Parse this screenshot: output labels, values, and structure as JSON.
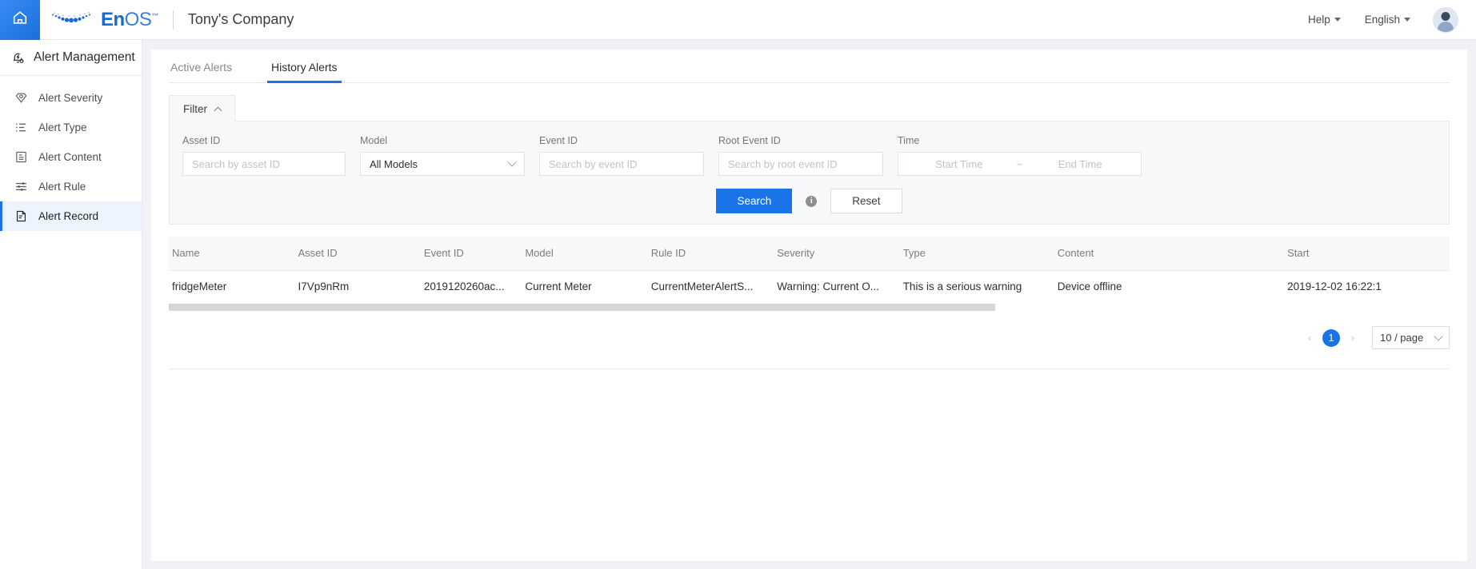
{
  "topbar": {
    "home_icon": "home-icon",
    "logo_text_en": "En",
    "logo_text_os": "OS",
    "logo_tm": "™",
    "company": "Tony's Company",
    "help": "Help",
    "language": "English",
    "avatar": "user-avatar"
  },
  "sidebar": {
    "title": "Alert Management",
    "title_icon": "alert-bell-icon",
    "items": [
      {
        "label": "Alert Severity",
        "icon": "severity-shield-icon",
        "active": false
      },
      {
        "label": "Alert Type",
        "icon": "list-icon",
        "active": false
      },
      {
        "label": "Alert Content",
        "icon": "document-icon",
        "active": false
      },
      {
        "label": "Alert Rule",
        "icon": "sliders-icon",
        "active": false
      },
      {
        "label": "Alert Record",
        "icon": "record-file-icon",
        "active": true
      }
    ]
  },
  "tabs": [
    {
      "label": "Active Alerts",
      "active": false
    },
    {
      "label": "History Alerts",
      "active": true
    }
  ],
  "filter": {
    "tab_label": "Filter",
    "fields": {
      "asset_id": {
        "label": "Asset ID",
        "placeholder": "Search by asset ID",
        "value": ""
      },
      "model": {
        "label": "Model",
        "selected": "All Models"
      },
      "event_id": {
        "label": "Event ID",
        "placeholder": "Search by event ID",
        "value": ""
      },
      "root_event_id": {
        "label": "Root Event ID",
        "placeholder": "Search by root event ID",
        "value": ""
      },
      "time": {
        "label": "Time",
        "start_placeholder": "Start Time",
        "separator": "~",
        "end_placeholder": "End Time"
      }
    },
    "search_label": "Search",
    "info_icon": "info-icon",
    "info_glyph": "i",
    "reset_label": "Reset"
  },
  "table": {
    "columns": [
      "Name",
      "Asset ID",
      "Event ID",
      "Model",
      "Rule ID",
      "Severity",
      "Type",
      "Content",
      "Start"
    ],
    "rows": [
      {
        "name": "fridgeMeter",
        "asset_id": "I7Vp9nRm",
        "event_id": "2019120260ac...",
        "model": "Current Meter",
        "rule_id": "CurrentMeterAlertS...",
        "severity": "Warning: Current O...",
        "type": "This is a serious warning",
        "content": "Device offline",
        "start": "2019-12-02 16:22:1"
      }
    ]
  },
  "pagination": {
    "prev": "‹",
    "current_page": "1",
    "next": "›",
    "page_size": "10 / page"
  },
  "colors": {
    "accent": "#1a73e8",
    "home_button": "#1f7aec",
    "panel_bg": "#f7f8fa",
    "page_bg": "#f0f2f5"
  }
}
